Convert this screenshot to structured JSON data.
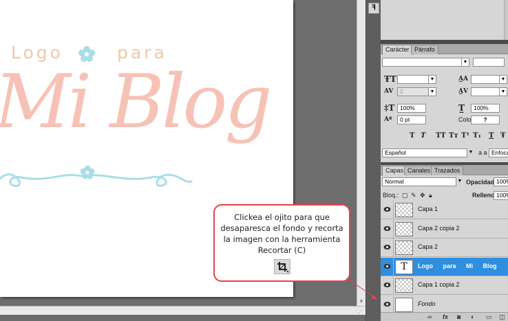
{
  "colors": {
    "accent_selected": "#2f8ee0",
    "callout_border": "#e8404a",
    "logo_peach": "#f0c9a6",
    "logo_pink": "#f7c2b6",
    "logo_blue": "#a9dde8"
  },
  "canvas": {
    "logo_word": "Logo",
    "para_word": "para",
    "mi_blog": "Mi Blog"
  },
  "callout": {
    "text": "Clickea el ojito para que desaparesca el fondo y recorta la imagen con la herramienta Recortar (C)",
    "icon": "crop-tool-icon"
  },
  "character_panel": {
    "tabs": [
      "Carácter",
      "Párrafo"
    ],
    "active_tab": "Carácter",
    "font_family": "",
    "font_style": "",
    "font_size": "",
    "leading": "",
    "kerning": "0",
    "tracking": "",
    "vertical_scale": "100%",
    "horizontal_scale": "100%",
    "baseline_shift": "0 pt",
    "color_label": "Color:",
    "color_value": "?",
    "style_buttons": [
      "T",
      "T",
      "TT",
      "Tт",
      "T¹",
      "T₁",
      "T",
      "Ŧ"
    ],
    "language": "Español",
    "antialias_label": "a a",
    "antialias_value": "Enfoca"
  },
  "layers_panel": {
    "tabs": [
      "Capas",
      "Canales",
      "Trazados"
    ],
    "active_tab": "Capas",
    "blend_mode": "Normal",
    "opacity_label": "Opacidad:",
    "opacity_value": "100%",
    "lock_label": "Bloq.:",
    "fill_label": "Relleno:",
    "fill_value": "100%",
    "layers": [
      {
        "name": "Capa 1",
        "visible": true,
        "thumb": "transparent",
        "selected": false
      },
      {
        "name": "Capa 2 copia 2",
        "visible": true,
        "thumb": "transparent",
        "selected": false
      },
      {
        "name": "Capa 2",
        "visible": true,
        "thumb": "transparent",
        "selected": false
      },
      {
        "name": "Logo para Mi Blog",
        "visible": true,
        "thumb": "text",
        "selected": true
      },
      {
        "name": "Capa 1 copia 2",
        "visible": true,
        "thumb": "transparent",
        "selected": false
      },
      {
        "name": "Fondo",
        "visible": true,
        "thumb": "white",
        "selected": false
      }
    ],
    "text_thumb_glyph": "T",
    "bottom_icons": [
      "link-icon",
      "fx-icon",
      "mask-icon",
      "adjustment-icon",
      "folder-icon",
      "new-layer-icon"
    ],
    "fx_label": "fx"
  },
  "strip": {
    "history_glyph": "ꟻ"
  }
}
